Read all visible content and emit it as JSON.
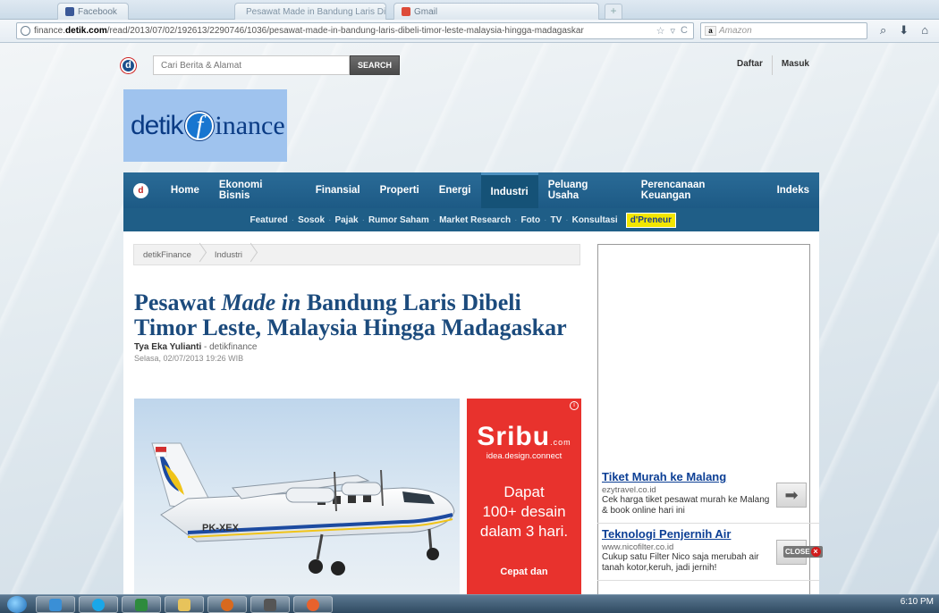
{
  "browser": {
    "tabs": [
      {
        "label": "Facebook"
      },
      {
        "label": "Pesawat Made in Bandung Laris Dibel...",
        "close": "×"
      },
      {
        "label": "Gmail"
      }
    ],
    "new_tab": "+",
    "url_domain": "finance.",
    "url_bold": "detik.com",
    "url_path": "/read/2013/07/02/192613/2290746/1036/pesawat-made-in-bandung-laris-dibeli-timor-leste-malaysia-hingga-madagaskar",
    "url_tools": [
      "☆",
      "▿",
      "C"
    ],
    "search_engine": "Amazon",
    "nav_icons": [
      "⌕",
      "⬇",
      "⌂"
    ]
  },
  "site": {
    "search_placeholder": "Cari Berita & Alamat",
    "search_button": "SEARCH",
    "top_links": [
      "Daftar",
      "Masuk"
    ],
    "logo": {
      "left": "detik",
      "f": "f",
      "right": "inance"
    },
    "mainnav": [
      "Home",
      "Ekonomi Bisnis",
      "Finansial",
      "Properti",
      "Energi",
      "Industri",
      "Peluang Usaha",
      "Perencanaan Keuangan",
      "Indeks"
    ],
    "active_nav": "Industri",
    "subnav": [
      "Featured",
      "Sosok",
      "Pajak",
      "Rumor Saham",
      "Market Research",
      "Foto",
      "TV",
      "Konsultasi"
    ],
    "subnav_badge": "d'Preneur"
  },
  "article": {
    "breadcrumb": [
      "detikFinance",
      "Industri"
    ],
    "headline_pre": "Pesawat ",
    "headline_italic": "Made in",
    "headline_post": " Bandung Laris Dibeli Timor Leste, Malaysia Hingga Madagaskar",
    "author": "Tya Eka Yulianti",
    "author_source": " - detikfinance",
    "date": "Selasa, 02/07/2013 19:26 WIB",
    "plane_registration": "PK-XEX"
  },
  "ad_sribu": {
    "logo": "Sribu",
    "logo_suffix": ".com",
    "tagline": "idea.design.connect",
    "line1": "Dapat",
    "line2": "100+ desain",
    "line3": "dalam 3 hari.",
    "cta": "Cepat dan",
    "info": "i"
  },
  "text_ads": [
    {
      "title": "Tiket Murah ke Malang",
      "url": "ezytravel.co.id",
      "desc": "Cek harga tiket pesawat murah ke Malang & book online hari ini"
    },
    {
      "title": "Teknologi Penjernih Air",
      "url": "www.nicofilter.co.id",
      "desc": "Cukup satu Filter Nico saja merubah air tanah kotor,keruh, jadi jernih!"
    }
  ],
  "close_badge": "CLOSE",
  "taskbar": {
    "clock": "6:10 PM"
  }
}
